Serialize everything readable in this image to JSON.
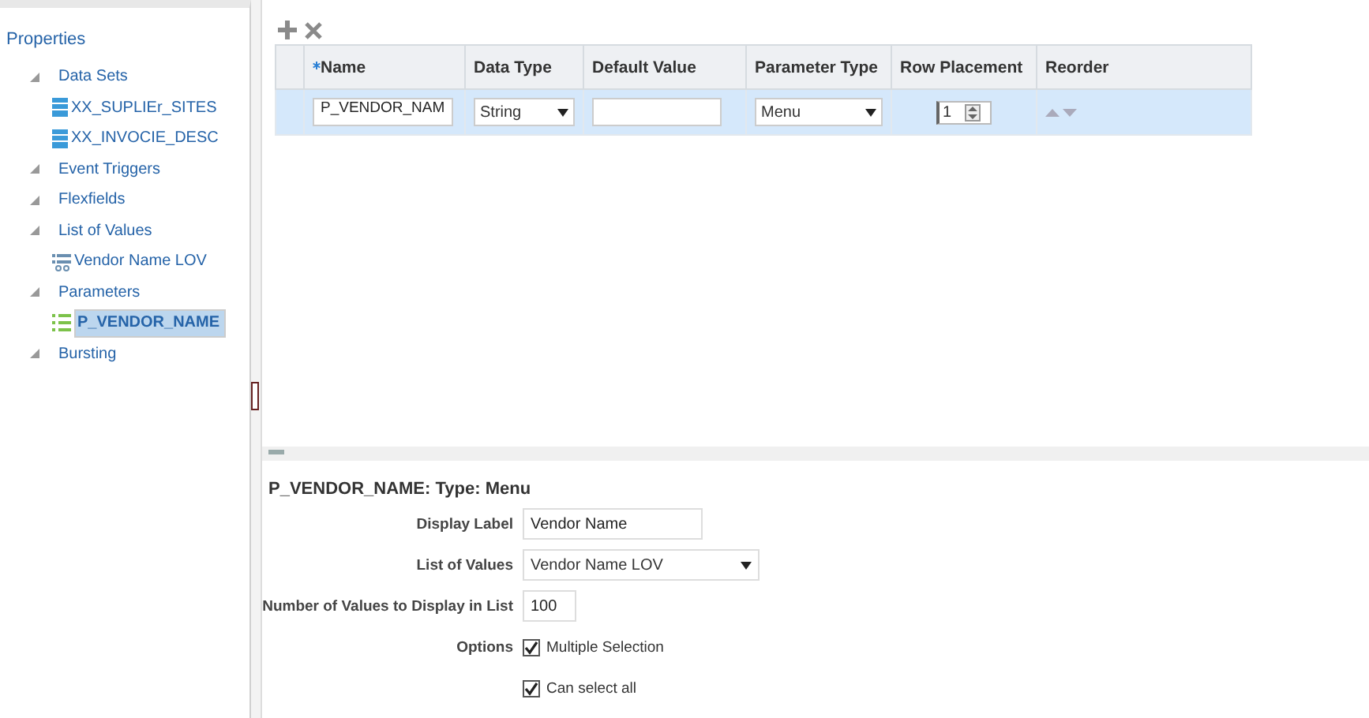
{
  "sidebar": {
    "root": "Properties",
    "items": [
      {
        "label": "Data Sets",
        "expanded": true,
        "children": [
          {
            "label": "XX_SUPLIEr_SITES",
            "kind": "dataset",
            "selected": false
          },
          {
            "label": "XX_INVOCIE_DESC",
            "kind": "dataset",
            "selected": false
          }
        ]
      },
      {
        "label": "Event Triggers",
        "expanded": true
      },
      {
        "label": "Flexfields",
        "expanded": true
      },
      {
        "label": "List of Values",
        "expanded": true,
        "children": [
          {
            "label": "Vendor Name LOV",
            "kind": "lov",
            "selected": false
          }
        ]
      },
      {
        "label": "Parameters",
        "expanded": true,
        "children": [
          {
            "label": "P_VENDOR_NAME",
            "kind": "parameter",
            "selected": true
          }
        ]
      },
      {
        "label": "Bursting",
        "expanded": true
      }
    ]
  },
  "table": {
    "columns": [
      {
        "label": "Name",
        "required": true
      },
      {
        "label": "Data Type",
        "required": false
      },
      {
        "label": "Default Value",
        "required": false
      },
      {
        "label": "Parameter Type",
        "required": false
      },
      {
        "label": "Row Placement",
        "required": false
      },
      {
        "label": "Reorder",
        "required": false
      }
    ],
    "rows": [
      {
        "selected": true,
        "name": "P_VENDOR_NAM",
        "data_type": "String",
        "default_value": "",
        "parameter_type": "Menu",
        "row_placement": "1"
      }
    ]
  },
  "details": {
    "title": "P_VENDOR_NAME: Type: Menu",
    "display_label_label": "Display Label",
    "display_label": "Vendor Name",
    "lov_label": "List of Values",
    "lov": "Vendor Name LOV",
    "count_label": "Number of Values to Display in List",
    "count": "100",
    "options_label": "Options",
    "options": [
      {
        "label": "Multiple Selection",
        "checked": true
      },
      {
        "label": "Can select all",
        "checked": true
      }
    ]
  }
}
